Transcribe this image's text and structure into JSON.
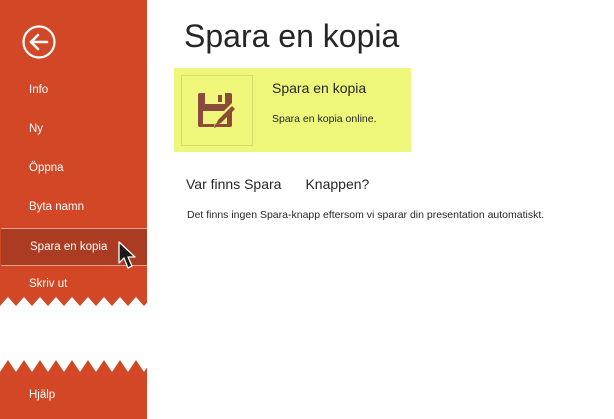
{
  "sidebar": {
    "back_label": "",
    "items": [
      {
        "label": "Info"
      },
      {
        "label": "Ny"
      },
      {
        "label": "Öppna"
      },
      {
        "label": "Byta namn"
      },
      {
        "label": "Spara en kopia"
      },
      {
        "label": "Skriv ut"
      },
      {
        "label": "Hjälp"
      }
    ],
    "selected_index": 4
  },
  "main": {
    "title": "Spara en kopia",
    "card": {
      "title": "Spara en kopia",
      "description": "Spara en kopia online.",
      "icon": "floppy-disk-pencil-icon"
    },
    "help": {
      "heading_part1": "Var finns Spara",
      "heading_part2": "Knappen?",
      "text": "Det finns ingen Spara-knapp eftersom vi sparar din presentation automatiskt."
    }
  },
  "colors": {
    "sidebar": "#d24726",
    "sidebar_selected": "#ab3b22",
    "card_highlight": "#eef77a",
    "icon_brown": "#8b4a3b"
  }
}
